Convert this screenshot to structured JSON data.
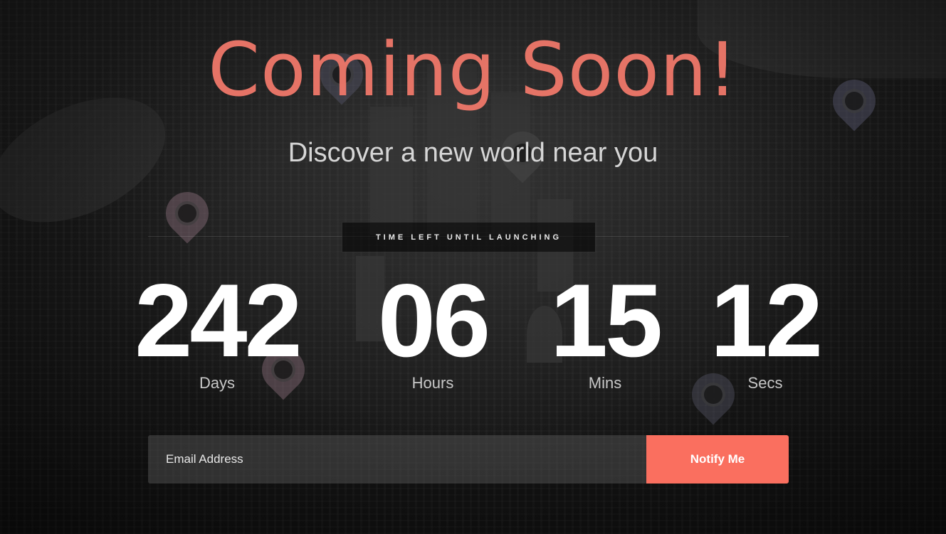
{
  "hero": {
    "title": "Coming Soon!",
    "subtitle": "Discover a new world near you"
  },
  "countdown": {
    "caption": "TIME LEFT UNTIL LAUNCHING",
    "units": [
      {
        "value": "242",
        "label": "Days"
      },
      {
        "value": "06",
        "label": "Hours"
      },
      {
        "value": "15",
        "label": "Mins"
      },
      {
        "value": "12",
        "label": "Secs"
      }
    ]
  },
  "subscribe": {
    "email_placeholder": "Email Address",
    "email_value": "",
    "button_label": "Notify Me"
  },
  "colors": {
    "accent": "#fa6f5f",
    "title": "#f0786a",
    "text": "#ffffff"
  },
  "icons": [
    "map-pin-icon"
  ]
}
